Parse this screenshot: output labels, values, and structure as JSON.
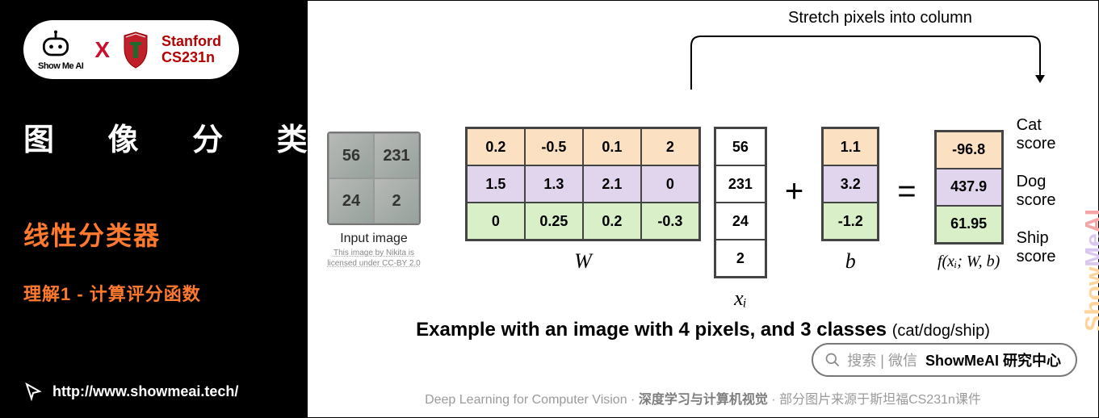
{
  "brand": {
    "logo_text": "Show Me AI",
    "x": "X",
    "stanford_l1": "Stanford",
    "stanford_l2": "CS231n"
  },
  "left": {
    "category": "图 像 分 类",
    "title": "线性分类器",
    "subtitle": "理解1 - 计算评分函数",
    "url": "http://www.showmeai.tech/"
  },
  "diagram": {
    "arrow_label": "Stretch pixels into column",
    "input": {
      "caption": "Input image",
      "credit_l1": "This image by Nikita is",
      "credit_l2": "licensed under CC-BY 2.0",
      "pixels": [
        "56",
        "231",
        "24",
        "2"
      ]
    },
    "W_label": "W",
    "x_label": "xᵢ",
    "b_label": "b",
    "f_label": "f(xᵢ; W, b)",
    "plus": "+",
    "eq": "=",
    "scores": [
      "Cat score",
      "Dog score",
      "Ship score"
    ]
  },
  "chart_data": {
    "type": "table",
    "title": "Linear classifier toy example: f = W·x + b",
    "W": [
      [
        0.2,
        -0.5,
        0.1,
        2.0
      ],
      [
        1.5,
        1.3,
        2.1,
        0.0
      ],
      [
        0,
        0.25,
        0.2,
        -0.3
      ]
    ],
    "x": [
      56,
      231,
      24,
      2
    ],
    "b": [
      1.1,
      3.2,
      -1.2
    ],
    "f": [
      -96.8,
      437.9,
      61.95
    ],
    "row_labels": [
      "Cat score",
      "Dog score",
      "Ship score"
    ]
  },
  "caption": {
    "main": "Example with an image with 4 pixels, and 3 classes",
    "sub": "(cat/dog/ship)"
  },
  "search": {
    "hint": "搜索 | 微信",
    "strong": "ShowMeAI 研究中心"
  },
  "footer": {
    "eng": "Deep Learning for Computer Vision",
    "dot": " · ",
    "bold": "深度学习与计算机视觉",
    "tail": "部分图片来源于斯坦福CS231n课件"
  },
  "watermark": "ShowMeAI"
}
